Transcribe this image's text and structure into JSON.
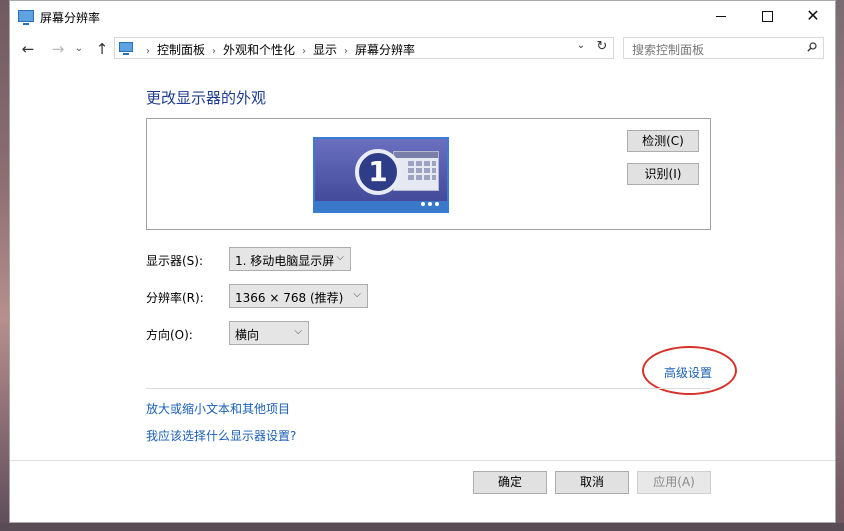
{
  "window": {
    "title": "屏幕分辨率"
  },
  "nav": {
    "back_icon": "arrow-left-icon",
    "forward_icon": "arrow-right-icon",
    "up_icon": "arrow-up-icon"
  },
  "breadcrumb": {
    "items": [
      "控制面板",
      "外观和个性化",
      "显示",
      "屏幕分辨率"
    ]
  },
  "search": {
    "placeholder": "搜索控制面板"
  },
  "main": {
    "heading": "更改显示器的外观",
    "monitor_number": "1",
    "detect_label": "检测(C)",
    "identify_label": "识别(I)"
  },
  "settings": {
    "display": {
      "label": "显示器(S):",
      "value": "1. 移动电脑显示屏"
    },
    "resolution": {
      "label": "分辨率(R):",
      "value": "1366 × 768 (推荐)"
    },
    "orientation": {
      "label": "方向(O):",
      "value": "横向"
    },
    "advanced_link": "高级设置"
  },
  "links": {
    "text_size": "放大或缩小文本和其他项目",
    "which_settings": "我应该选择什么显示器设置?"
  },
  "footer": {
    "ok": "确定",
    "cancel": "取消",
    "apply": "应用(A)"
  },
  "colors": {
    "link": "#1a5fb4",
    "heading": "#1e3d8f",
    "annotation": "#d6312a"
  }
}
